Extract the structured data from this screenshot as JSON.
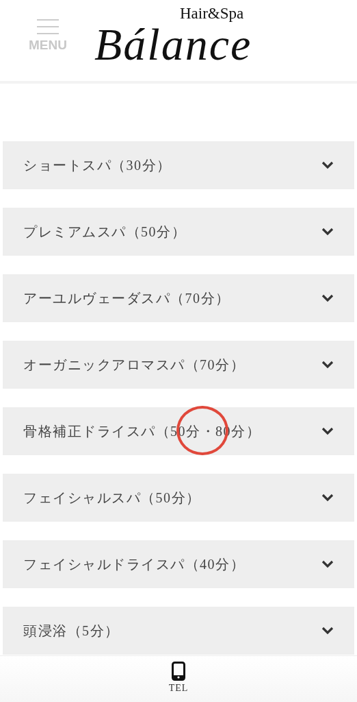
{
  "header": {
    "menu_label": "MENU",
    "logo": {
      "tagline": "Hair&Spa",
      "name": "Bálance"
    }
  },
  "items": [
    {
      "title": "ショートスパ（30分）",
      "expanded": false,
      "circled": false
    },
    {
      "title": "プレミアムスパ（50分）",
      "expanded": false,
      "circled": false
    },
    {
      "title": "アーユルヴェーダスパ（70分）",
      "expanded": false,
      "circled": false
    },
    {
      "title": "オーガニックアロマスパ（70分）",
      "expanded": false,
      "circled": false
    },
    {
      "title": "骨格補正ドライスパ（50分・80分）",
      "expanded": false,
      "circled": true
    },
    {
      "title": "フェイシャルスパ（50分）",
      "expanded": false,
      "circled": false
    },
    {
      "title": "フェイシャルドライスパ（40分）",
      "expanded": false,
      "circled": false
    },
    {
      "title": "頭浸浴（5分）",
      "expanded": false,
      "circled": false
    }
  ],
  "bottom_bar": {
    "tel_label": "TEL"
  }
}
